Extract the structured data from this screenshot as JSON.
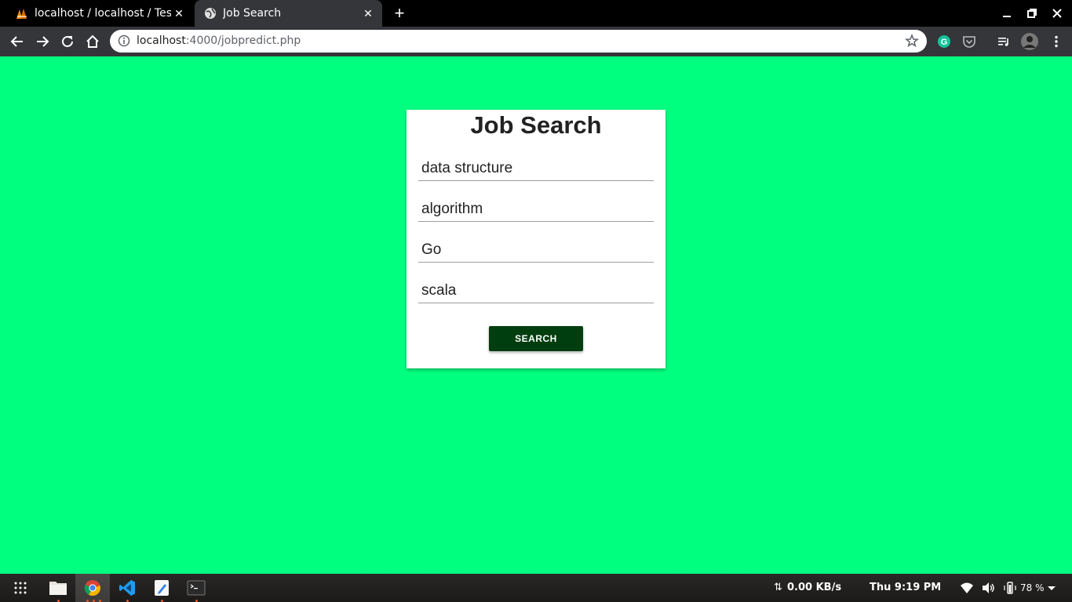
{
  "browser": {
    "tabs": [
      {
        "title": "localhost / localhost / Tes",
        "favicon": "phpmyadmin-icon",
        "active": false
      },
      {
        "title": "Job Search",
        "favicon": "globe-icon",
        "active": true
      }
    ],
    "url_host": "localhost",
    "url_path": ":4000/jobpredict.php"
  },
  "page": {
    "background": "#00ff7f",
    "heading": "Job Search",
    "fields": [
      {
        "value": "data structure"
      },
      {
        "value": "algorithm"
      },
      {
        "value": "Go"
      },
      {
        "value": "scala"
      }
    ],
    "search_label": "SEARCH",
    "button_color": "#003d0f"
  },
  "taskbar": {
    "apps": [
      "app-grid-icon",
      "files-icon",
      "chrome-icon",
      "vscode-icon",
      "text-editor-icon",
      "terminal-icon"
    ],
    "network_speed": "0.00 KB/s",
    "clock": "Thu  9:19 PM",
    "battery": "78 %"
  }
}
